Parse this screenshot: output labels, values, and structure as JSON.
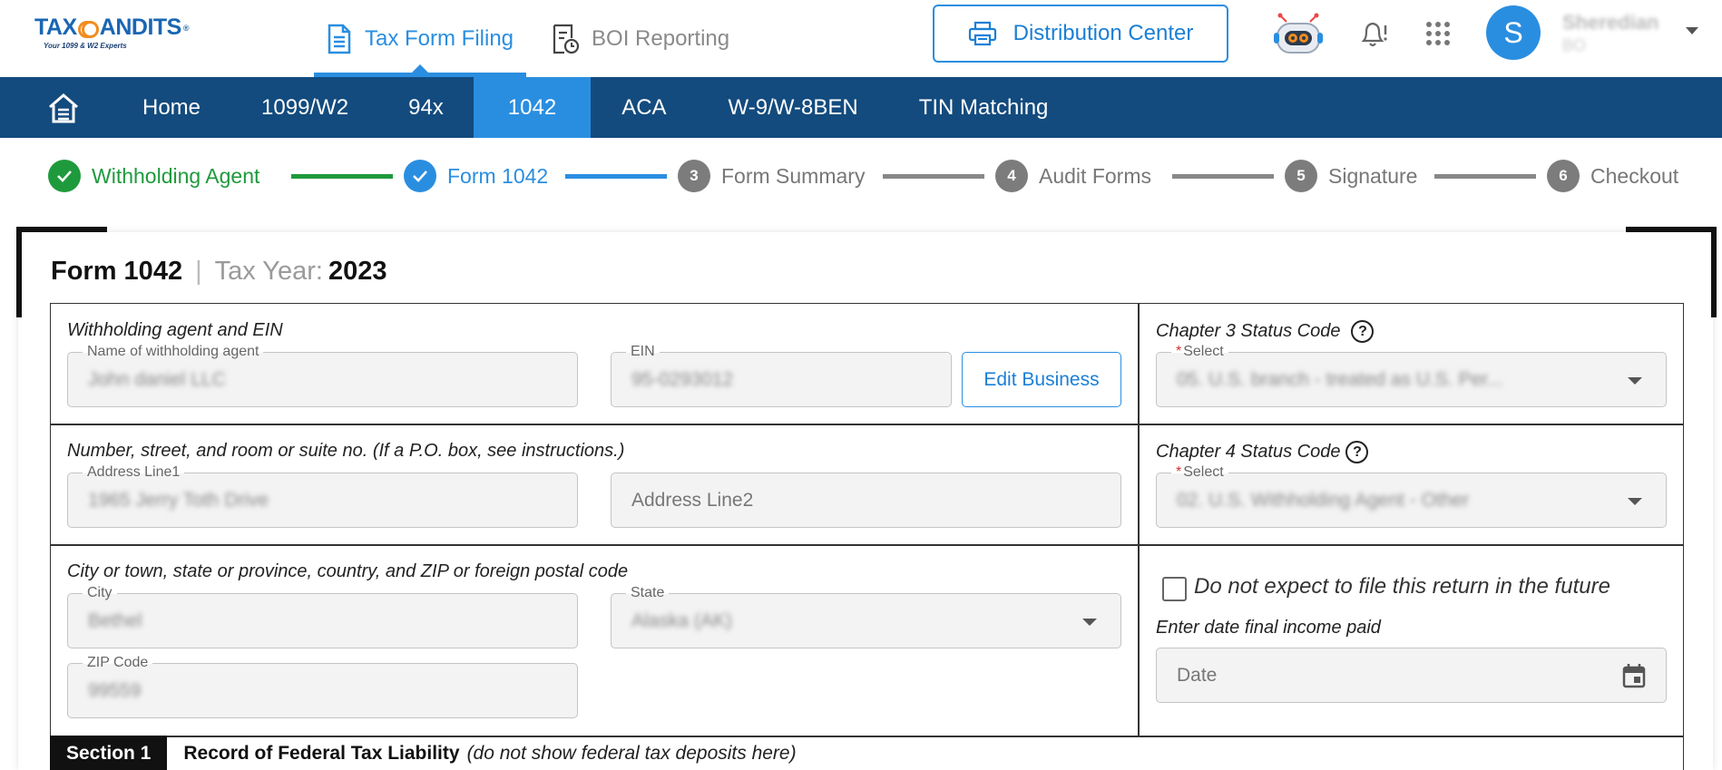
{
  "brand": {
    "name_left": "TAX",
    "name_right": "ANDITS",
    "registered": "®",
    "tagline": "Your 1099 & W2 Experts"
  },
  "top_nav": {
    "tax_form_filing": "Tax Form Filing",
    "boi_reporting": "BOI Reporting",
    "distribution_center": "Distribution Center"
  },
  "user": {
    "avatar_initial": "S",
    "name": "Sheredian",
    "subtitle": "BO"
  },
  "main_nav": {
    "items": [
      "Home",
      "1099/W2",
      "94x",
      "1042",
      "ACA",
      "W-9/W-8BEN",
      "TIN Matching"
    ],
    "active": "1042"
  },
  "stepper": {
    "steps": [
      {
        "number": "1",
        "label": "Withholding Agent",
        "status": "done"
      },
      {
        "number": "2",
        "label": "Form 1042",
        "status": "current"
      },
      {
        "number": "3",
        "label": "Form Summary",
        "status": "todo"
      },
      {
        "number": "4",
        "label": "Audit Forms",
        "status": "todo"
      },
      {
        "number": "5",
        "label": "Signature",
        "status": "todo"
      },
      {
        "number": "6",
        "label": "Checkout",
        "status": "todo"
      }
    ]
  },
  "form": {
    "title": "Form 1042",
    "separator": "|",
    "tax_year_label": "Tax Year:",
    "tax_year": "2023",
    "agent_section_label": "Withholding agent and EIN",
    "agent_name_label": "Name of withholding agent",
    "agent_name_value": "John daniel LLC",
    "ein_label": "EIN",
    "ein_value": "95-0293012",
    "edit_business": "Edit Business",
    "address_section_label": "Number, street, and room or suite no. (If a P.O. box, see instructions.)",
    "address1_label": "Address Line1",
    "address1_value": "1965 Jerry Toth Drive",
    "address2_placeholder": "Address Line2",
    "city_section_label": "City or town, state or province, country, and ZIP or foreign postal code",
    "city_label": "City",
    "city_value": "Bethel",
    "state_label": "State",
    "state_value": "Alaska (AK)",
    "zip_label": "ZIP Code",
    "zip_value": "99559",
    "ch3_label": "Chapter 3 Status Code",
    "ch3_select_label": "Select",
    "ch3_value": "05. U.S. branch - treated as U.S. Per...",
    "ch4_label": "Chapter 4 Status Code",
    "ch4_select_label": "Select",
    "ch4_value": "02. U.S. Withholding Agent - Other",
    "no_future_return": "Do not expect to file this return in the future",
    "final_income_label": "Enter date final income paid",
    "date_placeholder": "Date",
    "help_glyph": "?",
    "required_mark": "*"
  },
  "section1": {
    "tag": "Section 1",
    "title": "Record of Federal Tax Liability",
    "note": "(do not show federal tax deposits here)"
  },
  "colors": {
    "primary": "#2a8ee0",
    "nav_bg": "#134b7e",
    "done": "#1e9a3c",
    "todo": "#7c7c7c"
  }
}
